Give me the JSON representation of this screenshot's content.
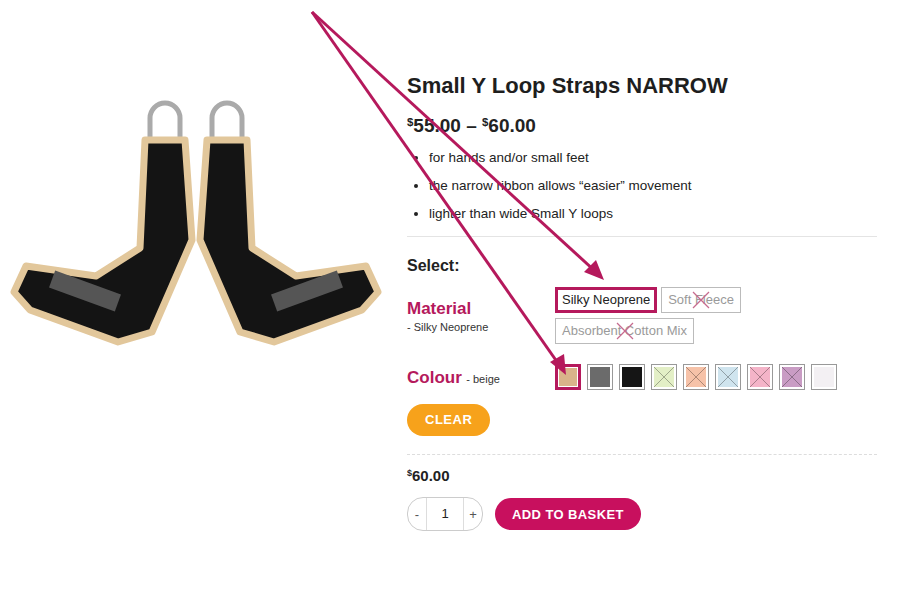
{
  "product": {
    "title": "Small Y Loop Straps NARROW",
    "price": {
      "currency": "$",
      "from": "55.00",
      "separator": "–",
      "to": "60.00"
    },
    "bullets": [
      "for hands and/or small feet",
      "the narrow ribbon allows “easier” movement",
      "lighter than wide Small Y loops"
    ]
  },
  "select_heading": "Select:",
  "material": {
    "label": "Material",
    "current": "- Silky Neoprene",
    "options": [
      {
        "label": "Silky Neoprene",
        "selected": true,
        "disabled": false
      },
      {
        "label": "Soft Fleece",
        "selected": false,
        "disabled": true
      },
      {
        "label": "Absorbent Cotton Mix",
        "selected": false,
        "disabled": true
      }
    ]
  },
  "colour": {
    "label": "Colour",
    "current": "- beige",
    "swatches": [
      {
        "color": "#d9b48a",
        "selected": true,
        "disabled": false
      },
      {
        "color": "#6b6b6b",
        "selected": false,
        "disabled": false
      },
      {
        "color": "#151515",
        "selected": false,
        "disabled": false
      },
      {
        "color": "#e3efc6",
        "selected": false,
        "disabled": true
      },
      {
        "color": "#f6c2a8",
        "selected": false,
        "disabled": true
      },
      {
        "color": "#cfe4ee",
        "selected": false,
        "disabled": true
      },
      {
        "color": "#f4b4c8",
        "selected": false,
        "disabled": true
      },
      {
        "color": "#c99cc4",
        "selected": false,
        "disabled": true
      },
      {
        "color": "#f3f0f3",
        "selected": false,
        "disabled": false
      }
    ]
  },
  "clear_button": "CLEAR",
  "total": {
    "currency": "$",
    "amount": "60.00"
  },
  "quantity": {
    "minus": "-",
    "value": "1",
    "plus": "+"
  },
  "add_button": "ADD TO BASKET"
}
